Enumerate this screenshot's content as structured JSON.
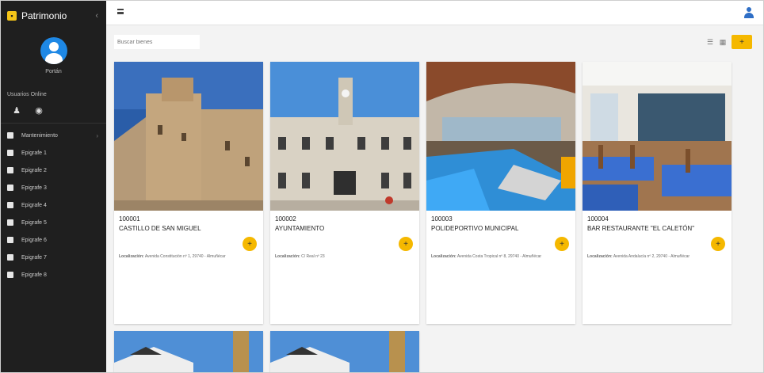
{
  "sidebar": {
    "brand": "Patrimonio",
    "toggle": "‹",
    "username": "Portán",
    "section_label": "Usuarios Online",
    "menu": [
      {
        "label": "Mantenimiento",
        "expand": "›"
      },
      {
        "label": "Epigrafe 1"
      },
      {
        "label": "Epigrafe 2"
      },
      {
        "label": "Epigrafe 3"
      },
      {
        "label": "Epigrafe 4"
      },
      {
        "label": "Epigrafe 5"
      },
      {
        "label": "Epigrafe 6"
      },
      {
        "label": "Epigrafe 7"
      },
      {
        "label": "Epigrafe 8"
      }
    ]
  },
  "topbar": {
    "menu_icon": "hamburger-icon",
    "user_icon": "user-icon",
    "accent": "#2f6fc6"
  },
  "toolbar": {
    "search_placeholder": "Buscar bienes",
    "view_list_icon": "☰",
    "view_grid_icon": "▦",
    "add_label": "+"
  },
  "cards": [
    {
      "code": "100001",
      "title": "CASTILLO DE SAN MIGUEL",
      "fab": "+",
      "location_label": "Localización:",
      "location": "Avenida Constitución nº 1, 29740 - Almuñécar"
    },
    {
      "code": "100002",
      "title": "AYUNTAMIENTO",
      "fab": "+",
      "location_label": "Localización:",
      "location": "C/ Real nº 23"
    },
    {
      "code": "100003",
      "title": "POLIDEPORTIVO MUNICIPAL",
      "fab": "+",
      "location_label": "Localización:",
      "location": "Avenida Costa Tropical nº 8, 29740 - Almuñécar"
    },
    {
      "code": "100004",
      "title": "BAR RESTAURANTE \"EL CALETÓN\"",
      "fab": "+",
      "location_label": "Localización:",
      "location": "Avenida Andalucía nº 2, 29740 - Almuñécar"
    }
  ],
  "colors": {
    "accent": "#f5b800",
    "sidebar_bg": "#1f1f1f"
  }
}
